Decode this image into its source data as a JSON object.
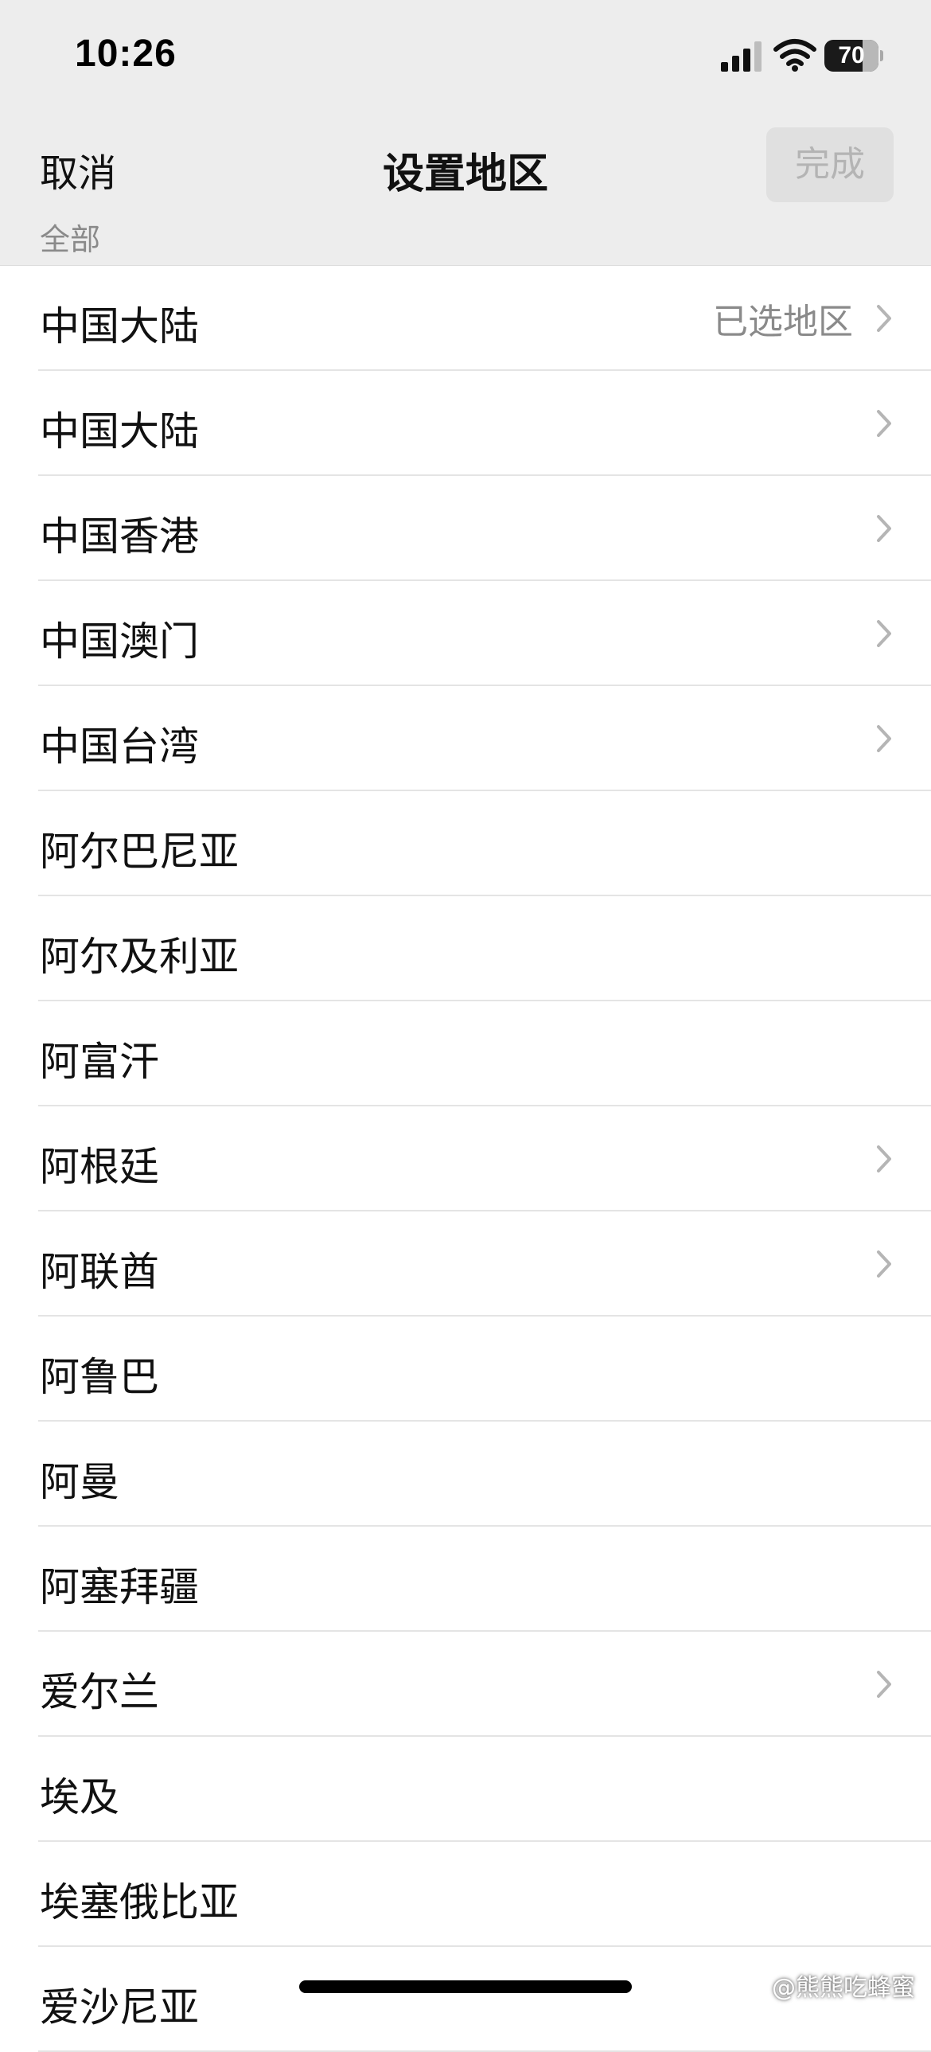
{
  "status_bar": {
    "time": "10:26",
    "battery_level": "70"
  },
  "nav": {
    "cancel_label": "取消",
    "title": "设置地区",
    "done_label": "完成"
  },
  "section_header": "全部",
  "regions": [
    {
      "name": "中国大陆",
      "status": "已选地区",
      "has_chevron": true
    },
    {
      "name": "中国大陆",
      "status": "",
      "has_chevron": true
    },
    {
      "name": "中国香港",
      "status": "",
      "has_chevron": true
    },
    {
      "name": "中国澳门",
      "status": "",
      "has_chevron": true
    },
    {
      "name": "中国台湾",
      "status": "",
      "has_chevron": true
    },
    {
      "name": "阿尔巴尼亚",
      "status": "",
      "has_chevron": false
    },
    {
      "name": "阿尔及利亚",
      "status": "",
      "has_chevron": false
    },
    {
      "name": "阿富汗",
      "status": "",
      "has_chevron": false
    },
    {
      "name": "阿根廷",
      "status": "",
      "has_chevron": true
    },
    {
      "name": "阿联酋",
      "status": "",
      "has_chevron": true
    },
    {
      "name": "阿鲁巴",
      "status": "",
      "has_chevron": false
    },
    {
      "name": "阿曼",
      "status": "",
      "has_chevron": false
    },
    {
      "name": "阿塞拜疆",
      "status": "",
      "has_chevron": false
    },
    {
      "name": "爱尔兰",
      "status": "",
      "has_chevron": true
    },
    {
      "name": "埃及",
      "status": "",
      "has_chevron": false
    },
    {
      "name": "埃塞俄比亚",
      "status": "",
      "has_chevron": false
    },
    {
      "name": "爱沙尼亚",
      "status": "",
      "has_chevron": false
    }
  ],
  "watermark": "@熊熊吃蜂蜜",
  "colors": {
    "header_bg": "#ededed",
    "list_bg": "#ffffff",
    "secondary_text": "#8a8a8a",
    "chevron": "#b5b5b5",
    "done_button_bg": "#e0e0e0"
  },
  "icons": {
    "signal": "cellular-signal-icon",
    "wifi": "wifi-icon",
    "chevron": "chevron-right-icon",
    "watermark_logo": "watermark-logo-icon"
  }
}
